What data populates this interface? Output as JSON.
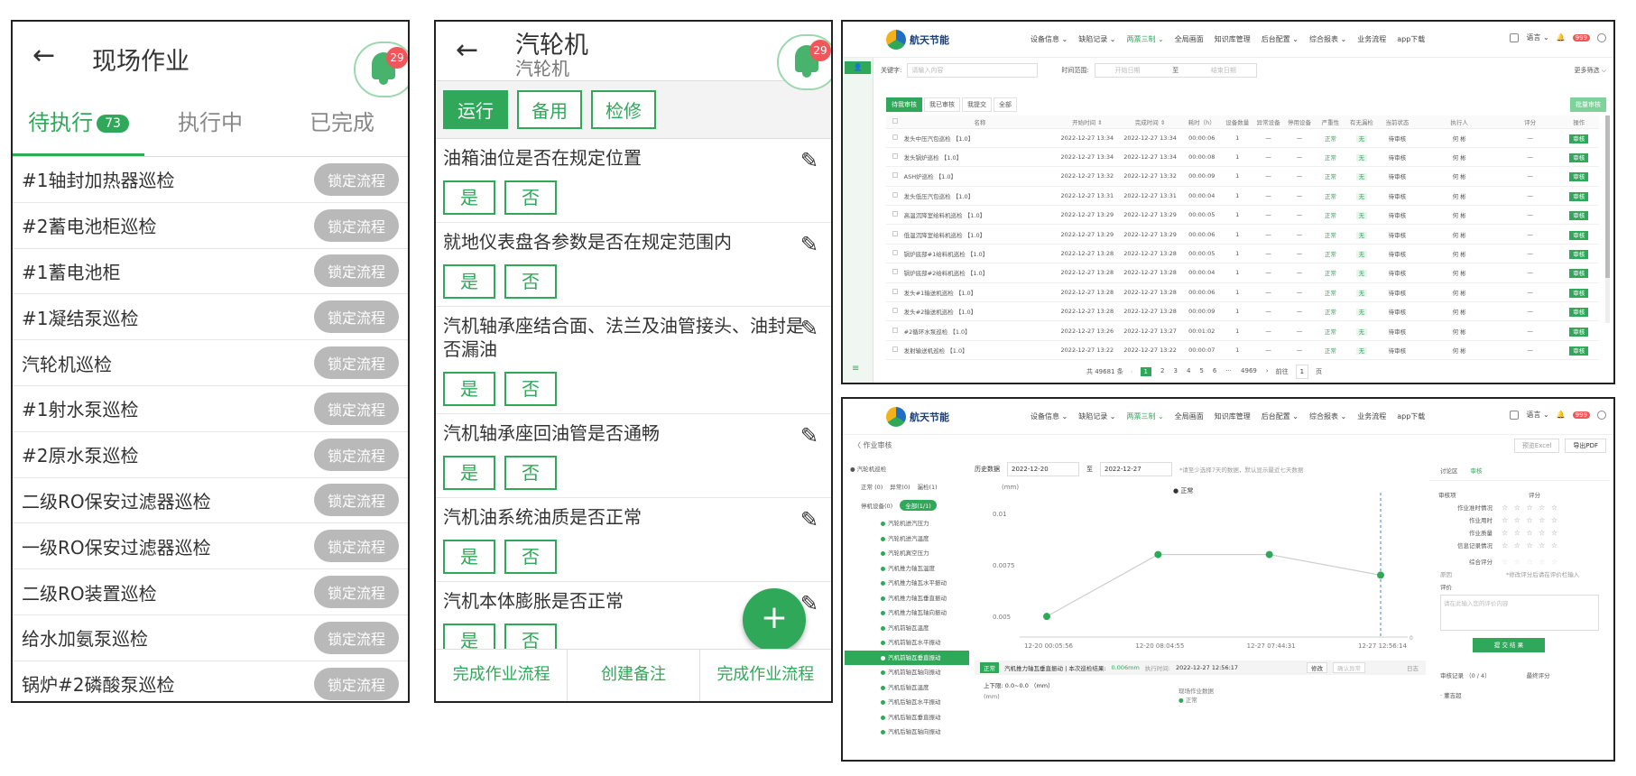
{
  "p1": {
    "title": "现场作业",
    "notify_count": "29",
    "tabs": [
      {
        "label": "待执行",
        "badge": "73"
      },
      {
        "label": "执行中"
      },
      {
        "label": "已完成"
      }
    ],
    "lock_label": "锁定流程",
    "items": [
      "#1轴封加热器巡检",
      "#2蓄电池柜巡检",
      "#1蓄电池柜",
      "#1凝结泵巡检",
      "汽轮机巡检",
      "#1射水泵巡检",
      "#2原水泵巡检",
      "二级RO保安过滤器巡检",
      "一级RO保安过滤器巡检",
      "二级RO装置巡检",
      "给水加氨泵巡检",
      "锅炉#2磷酸泵巡检"
    ]
  },
  "p2": {
    "title": "汽轮机",
    "subtitle": "汽轮机",
    "notify_count": "29",
    "states": [
      "运行",
      "备用",
      "检修"
    ],
    "yes": "是",
    "no": "否",
    "fab": "+",
    "questions": [
      "油箱油位是否在规定位置",
      "就地仪表盘各参数是否在规定范围内",
      "汽机轴承座结合面、法兰及油管接头、油封是否漏油",
      "汽机轴承座回油管是否通畅",
      "汽机油系统油质是否正常",
      "汽机本体膨胀是否正常"
    ],
    "bottom": [
      "完成作业流程",
      "创建备注",
      "完成作业流程"
    ]
  },
  "desk": {
    "brand": "航天节能",
    "menu": [
      "设备信息 ⌄",
      "缺陷记录 ⌄",
      "两票三制 ⌄",
      "全局画面",
      "知识库管理",
      "后台配置 ⌄",
      "综合报表 ⌄",
      "业务流程",
      "app下载"
    ],
    "lang": "语言 ⌄",
    "notify_count": "999"
  },
  "p3": {
    "keyword_label": "关键字:",
    "keyword_placeholder": "请输入内容",
    "time_label": "时间范围:",
    "start_placeholder": "开始日期",
    "to": "至",
    "end_placeholder": "结束日期",
    "more": "更多筛选 ⌵",
    "filter_tabs": [
      "待我审核",
      "我已审核",
      "我提交",
      "全部"
    ],
    "batch_btn": "批量审核",
    "columns": [
      "",
      "名称",
      "开始时间 ⇕",
      "完成时间 ⇕",
      "耗时（h）",
      "设备数量",
      "异常设备",
      "停用设备",
      "严重性",
      "有无漏检",
      "当前状态",
      "执行人",
      "评分",
      "操作"
    ],
    "rows": [
      [
        "发头中压汽包巡检 【1.0】",
        "2022-12-27 13:34",
        "2022-12-27 13:34",
        "00:00:06"
      ],
      [
        "发头锅炉巡检 【1.0】",
        "2022-12-27 13:34",
        "2022-12-27 13:34",
        "00:00:08"
      ],
      [
        "ASH炉巡检 【1.0】",
        "2022-12-27 13:32",
        "2022-12-27 13:32",
        "00:00:09"
      ],
      [
        "发头低压汽包巡检 【1.0】",
        "2022-12-27 13:31",
        "2022-12-27 13:31",
        "00:00:04"
      ],
      [
        "高温沉降室给料机巡检 【1.0】",
        "2022-12-27 13:29",
        "2022-12-27 13:29",
        "00:00:05"
      ],
      [
        "低温沉降室给料机巡检 【1.0】",
        "2022-12-27 13:29",
        "2022-12-27 13:29",
        "00:00:06"
      ],
      [
        "锅炉底部#1给料机巡检 【1.0】",
        "2022-12-27 13:28",
        "2022-12-27 13:28",
        "00:00:05"
      ],
      [
        "锅炉底部#2给料机巡检 【1.0】",
        "2022-12-27 13:28",
        "2022-12-27 13:28",
        "00:00:04"
      ],
      [
        "发头#1输送机巡检 【1.0】",
        "2022-12-27 13:28",
        "2022-12-27 13:28",
        "00:00:06"
      ],
      [
        "发头#2输送机巡检 【1.0】",
        "2022-12-27 13:28",
        "2022-12-27 13:28",
        "00:00:09"
      ],
      [
        "#2循环水泵巡检 【1.0】",
        "2022-12-27 13:26",
        "2022-12-27 13:27",
        "00:01:02"
      ],
      [
        "发射输送机巡检 【1.0】",
        "2022-12-27 13:22",
        "2022-12-27 13:22",
        "00:00:07"
      ]
    ],
    "count": "1",
    "dash": "—",
    "severity": "正常",
    "missed": "无",
    "status": "待审核",
    "executor": "何 彬",
    "op": "审核",
    "total": "共 49681 条",
    "pages": [
      "1",
      "2",
      "3",
      "4",
      "5",
      "6",
      "···",
      "4969",
      "›"
    ],
    "goto": "前往",
    "goto_val": "1",
    "page_unit": "页"
  },
  "p4": {
    "breadcrumb": "〈 作业审核",
    "btn_preview": "预览Excel",
    "btn_pdf": "导出PDF",
    "root": "汽轮机巡检",
    "counts": [
      "正常 (0)",
      "异常(0)",
      "漏检(1)"
    ],
    "counts2": [
      "停机设备(0)",
      "全部(1/1)"
    ],
    "items": [
      "汽轮机进汽压力",
      "汽轮机进汽温度",
      "汽轮机真空压力",
      "汽机推力轴瓦温度",
      "汽机推力轴瓦水平振动",
      "汽机推力轴瓦垂直振动",
      "汽机推力轴瓦轴向振动",
      "汽机前轴瓦温度",
      "汽机前轴瓦水平振动",
      "汽机前轴瓦垂直振动",
      "汽机前轴瓦轴向振动",
      "汽机后轴瓦温度",
      "汽机后轴瓦水平振动",
      "汽机后轴瓦垂直振动",
      "汽机后轴瓦轴向振动"
    ],
    "active_index": 9,
    "hist_label": "历史数据",
    "from": "2022-12-20",
    "to_label": "至",
    "to": "2022-12-27",
    "hint": "*请至少选择7天的数据，默认显示最近七天数据",
    "status_tag": "正常",
    "status_text": "汽机推力轴瓦垂直振动 | 本次巡检结果:",
    "status_value": "0.006mm",
    "exec_time_label": "执行时间:",
    "exec_time": "2022-12-27 12:56:17",
    "btn_modify": "修改",
    "btn_confirm": "确认异常",
    "log": "日志",
    "limits": "上下限: 0.0~0.0 （mm）",
    "legend2_title": "现场作业数据",
    "right_tabs": [
      "讨论区",
      "审核"
    ],
    "rate_head": [
      "审核项",
      "评分"
    ],
    "rate_items": [
      "作业准时情况",
      "作业用时",
      "作业质量",
      "信息记录情况"
    ],
    "overall": "综合评分",
    "overall_hint": "*修改评分后请在评价栏输入",
    "reason": "原因",
    "comment": "评价",
    "comment_placeholder": "请在此输入您的评价内容",
    "submit": "提 交 结 果",
    "records": "审核记录 （0 / 4）",
    "final_score": "最终评分",
    "reviewer": "· 董吉超",
    "stars": "☆ ☆ ☆ ☆ ☆"
  },
  "chart_data": {
    "type": "line",
    "ylabel": "(mm)",
    "legend": "正常",
    "yticks": [
      "0.01",
      "0.0075",
      "0.005"
    ],
    "xticks": [
      "12-20 00:05:56",
      "12-20 08:04:55",
      "12-27 07:44:31",
      "12-27 12:56:14"
    ],
    "x": [
      "12-20 00:05:56",
      "12-20 08:04:55",
      "12-27 07:44:31",
      "12-27 12:56:14"
    ],
    "y": [
      0.005,
      0.008,
      0.008,
      0.007
    ],
    "ylim": [
      0.004,
      0.011
    ],
    "series_color": "#2fa85a",
    "line_color": "#cccccc"
  }
}
